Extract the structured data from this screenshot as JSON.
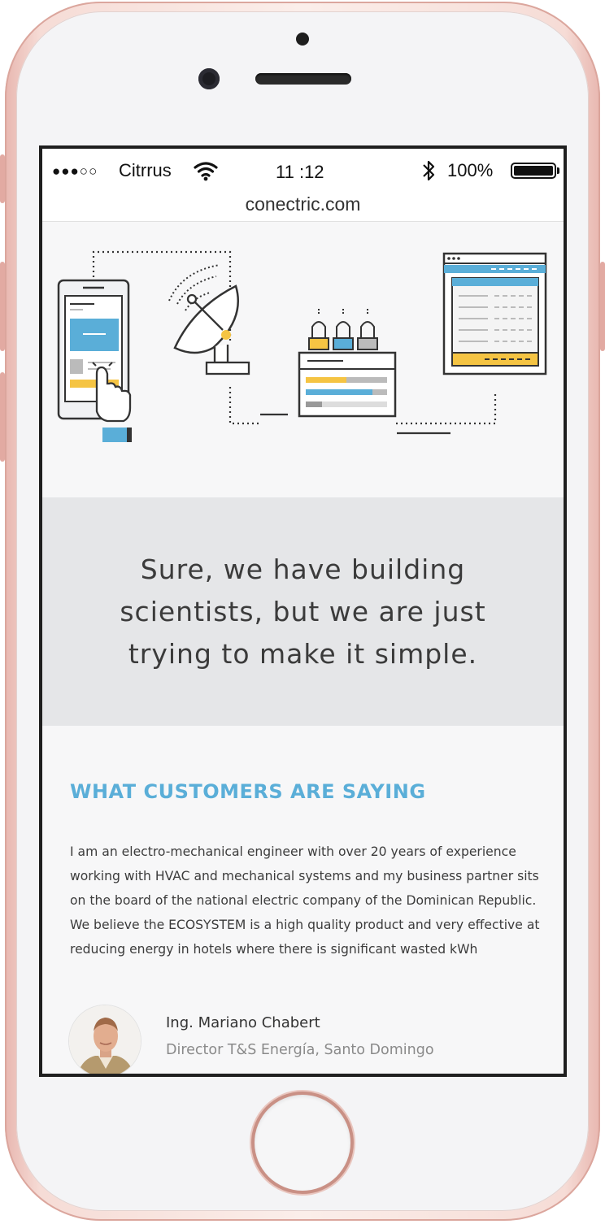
{
  "status_bar": {
    "signal": "●●●○○",
    "carrier": "Citrrus",
    "time": "11 :12",
    "battery": "100%",
    "icons": [
      "wifi-icon",
      "bluetooth-icon",
      "battery-icon"
    ]
  },
  "browser": {
    "url": "conectric.com"
  },
  "hero": {
    "tagline": "Sure, we have building scientists, but we are just trying to make it simple."
  },
  "customers": {
    "heading": "WHAT CUSTOMERS ARE SAYING",
    "testimonial": "I am an electro-mechanical engineer with over 20 years of experience working with HVAC and mechanical systems and my business partner sits on the board of the national electric company of the Dominican Republic.  We believe the ECOSYSTEM is a high quality product and very effective at reducing energy in hotels where there is significant wasted kWh",
    "person": {
      "name": "Ing. Mariano Chabert",
      "role": "Director T&S Energía, Santo Domingo"
    }
  },
  "colors": {
    "accent_blue": "#5aaed8",
    "accent_yellow": "#f5c443",
    "quote_band": "#e5e6e8",
    "phone_rose": "#f6dcd6"
  }
}
